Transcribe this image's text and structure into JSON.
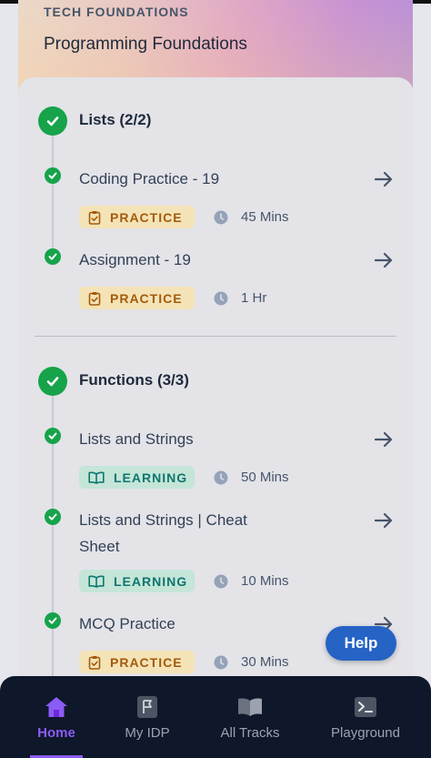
{
  "header": {
    "track_label": "TECH FOUNDATIONS",
    "course_title": "Programming Foundations"
  },
  "sections": [
    {
      "title": "Lists (2/2)",
      "items": [
        {
          "title": "Coding Practice - 19",
          "badge": "PRACTICE",
          "duration": "45 Mins"
        },
        {
          "title": "Assignment - 19",
          "badge": "PRACTICE",
          "duration": "1 Hr"
        }
      ]
    },
    {
      "title": "Functions (3/3)",
      "items": [
        {
          "title_line1": "Lists and Strings",
          "badge": "LEARNING",
          "duration": "50 Mins"
        },
        {
          "title_line1": "Lists and Strings | Cheat",
          "title_line2": "Sheet",
          "badge": "LEARNING",
          "duration": "10 Mins"
        },
        {
          "title_line1": "MCQ Practice",
          "badge": "PRACTICE",
          "duration": "30 Mins"
        }
      ]
    }
  ],
  "help_label": "Help",
  "nav": [
    {
      "label": "Home",
      "icon": "home-icon",
      "active": true
    },
    {
      "label": "My IDP",
      "icon": "flag-icon",
      "active": false
    },
    {
      "label": "All Tracks",
      "icon": "book-icon",
      "active": false
    },
    {
      "label": "Playground",
      "icon": "terminal-icon",
      "active": false
    }
  ],
  "colors": {
    "complete": "#16a34a",
    "practice_bg": "#f4e3b6",
    "practice_fg": "#a35b0a",
    "learning_bg": "#c4e5d8",
    "learning_fg": "#0f766e",
    "help": "#2563c5",
    "nav_active": "#8b5cf6",
    "nav_bg": "#0f172a"
  }
}
